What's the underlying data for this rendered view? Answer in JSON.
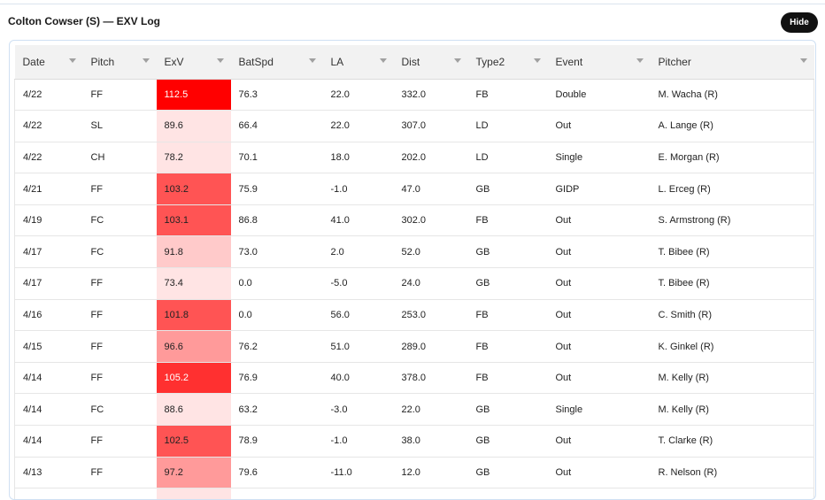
{
  "header": {
    "title": "Colton Cowser (S) — EXV Log",
    "hide_label": "Hide"
  },
  "table": {
    "columns": [
      "Date",
      "Pitch",
      "ExV",
      "BatSpd",
      "LA",
      "Dist",
      "Type2",
      "Event",
      "Pitcher"
    ],
    "rows": [
      {
        "date": "4/22",
        "pitch": "FF",
        "exv": "112.5",
        "exv_color": "#ff0000",
        "batspd": "76.3",
        "la": "22.0",
        "dist": "332.0",
        "type2": "FB",
        "event": "Double",
        "pitcher": "M. Wacha (R)"
      },
      {
        "date": "4/22",
        "pitch": "SL",
        "exv": "89.6",
        "exv_color": "#ffe4e4",
        "batspd": "66.4",
        "la": "22.0",
        "dist": "307.0",
        "type2": "LD",
        "event": "Out",
        "pitcher": "A. Lange (R)"
      },
      {
        "date": "4/22",
        "pitch": "CH",
        "exv": "78.2",
        "exv_color": "#ffe4e4",
        "batspd": "70.1",
        "la": "18.0",
        "dist": "202.0",
        "type2": "LD",
        "event": "Single",
        "pitcher": "E. Morgan (R)"
      },
      {
        "date": "4/21",
        "pitch": "FF",
        "exv": "103.2",
        "exv_color": "#ff5454",
        "batspd": "75.9",
        "la": "-1.0",
        "dist": "47.0",
        "type2": "GB",
        "event": "GIDP",
        "pitcher": "L. Erceg (R)"
      },
      {
        "date": "4/19",
        "pitch": "FC",
        "exv": "103.1",
        "exv_color": "#ff5454",
        "batspd": "86.8",
        "la": "41.0",
        "dist": "302.0",
        "type2": "FB",
        "event": "Out",
        "pitcher": "S. Armstrong (R)"
      },
      {
        "date": "4/17",
        "pitch": "FC",
        "exv": "91.8",
        "exv_color": "#ffcaca",
        "batspd": "73.0",
        "la": "2.0",
        "dist": "52.0",
        "type2": "GB",
        "event": "Out",
        "pitcher": "T. Bibee (R)"
      },
      {
        "date": "4/17",
        "pitch": "FF",
        "exv": "73.4",
        "exv_color": "#ffe4e4",
        "batspd": "0.0",
        "la": "-5.0",
        "dist": "24.0",
        "type2": "GB",
        "event": "Out",
        "pitcher": "T. Bibee (R)"
      },
      {
        "date": "4/16",
        "pitch": "FF",
        "exv": "101.8",
        "exv_color": "#ff5454",
        "batspd": "0.0",
        "la": "56.0",
        "dist": "253.0",
        "type2": "FB",
        "event": "Out",
        "pitcher": "C. Smith (R)"
      },
      {
        "date": "4/15",
        "pitch": "FF",
        "exv": "96.6",
        "exv_color": "#ff9a9a",
        "batspd": "76.2",
        "la": "51.0",
        "dist": "289.0",
        "type2": "FB",
        "event": "Out",
        "pitcher": "K. Ginkel (R)"
      },
      {
        "date": "4/14",
        "pitch": "FF",
        "exv": "105.2",
        "exv_color": "#ff3030",
        "batspd": "76.9",
        "la": "40.0",
        "dist": "378.0",
        "type2": "FB",
        "event": "Out",
        "pitcher": "M. Kelly (R)"
      },
      {
        "date": "4/14",
        "pitch": "FC",
        "exv": "88.6",
        "exv_color": "#ffe4e4",
        "batspd": "63.2",
        "la": "-3.0",
        "dist": "22.0",
        "type2": "GB",
        "event": "Single",
        "pitcher": "M. Kelly (R)"
      },
      {
        "date": "4/14",
        "pitch": "FF",
        "exv": "102.5",
        "exv_color": "#ff5454",
        "batspd": "78.9",
        "la": "-1.0",
        "dist": "38.0",
        "type2": "GB",
        "event": "Out",
        "pitcher": "T. Clarke (R)"
      },
      {
        "date": "4/13",
        "pitch": "FF",
        "exv": "97.2",
        "exv_color": "#ff9a9a",
        "batspd": "79.6",
        "la": "-11.0",
        "dist": "12.0",
        "type2": "GB",
        "event": "Out",
        "pitcher": "R. Nelson (R)"
      },
      {
        "date": "",
        "pitch": "",
        "exv": "",
        "exv_color": "#ffe4e4",
        "batspd": "",
        "la": "",
        "dist": "",
        "type2": "",
        "event": "",
        "pitcher": ""
      }
    ]
  }
}
